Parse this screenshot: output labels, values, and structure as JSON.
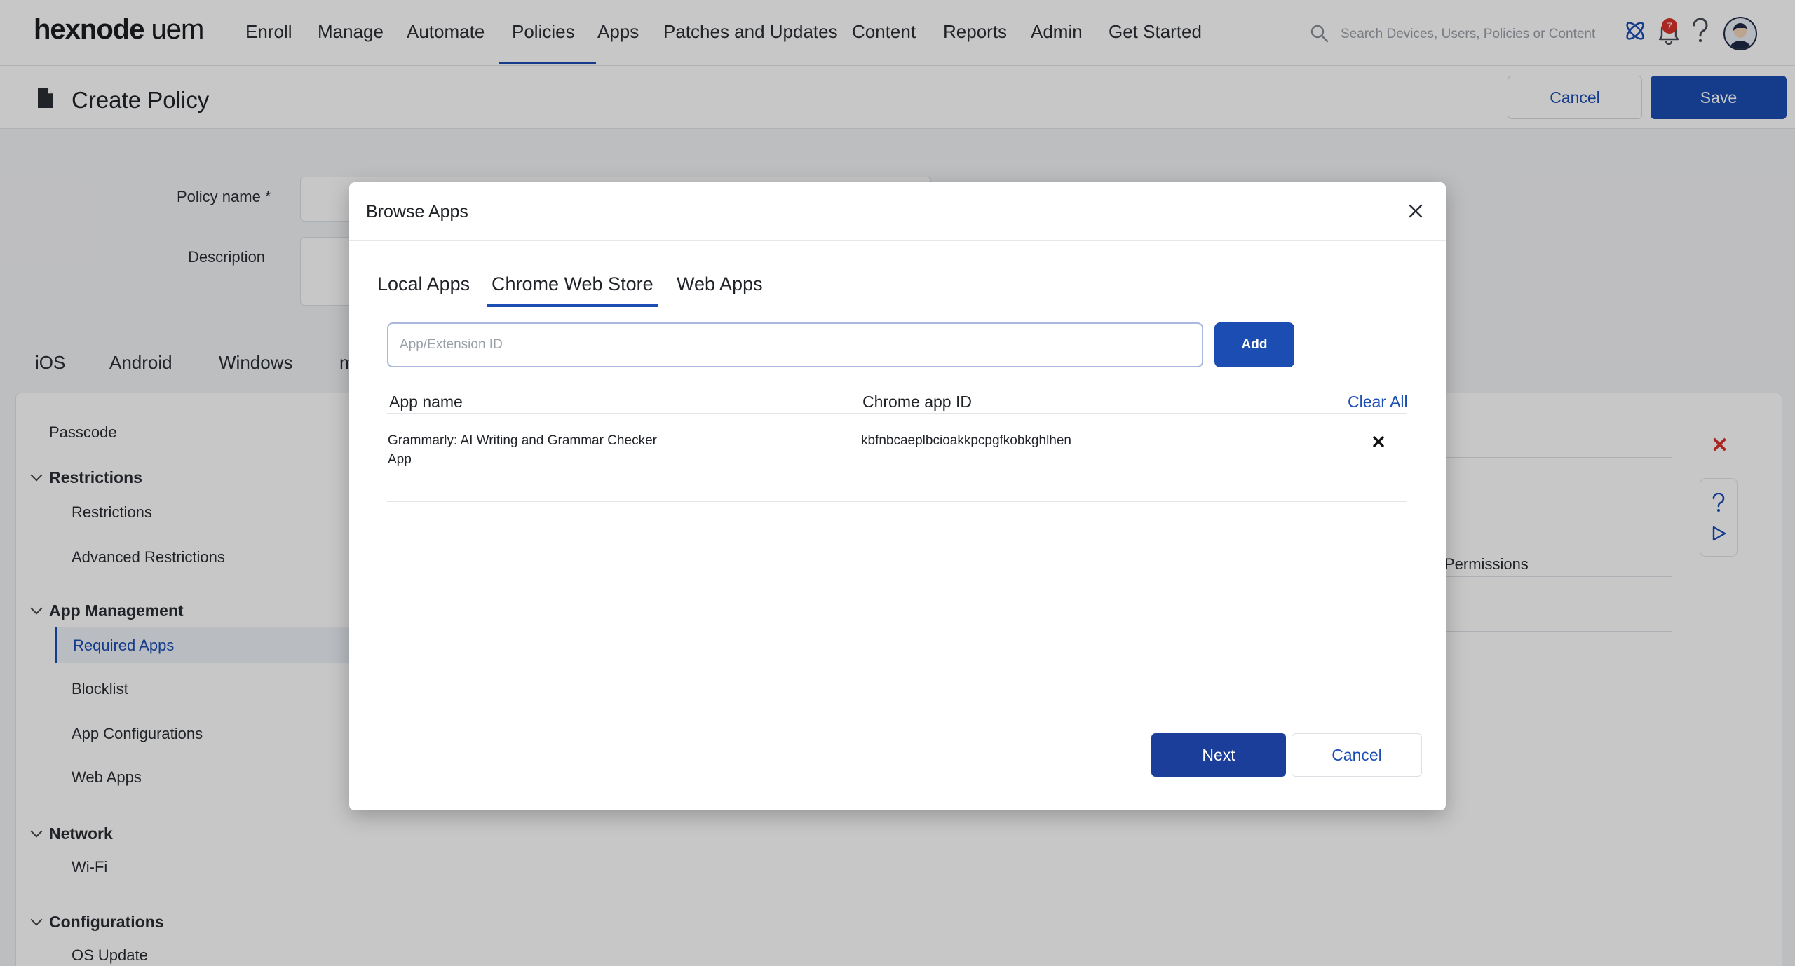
{
  "brand": {
    "name": "hexnode",
    "product": "uem",
    "accent": "#1b4db3"
  },
  "nav": {
    "items": [
      {
        "label": "Enroll"
      },
      {
        "label": "Manage"
      },
      {
        "label": "Automate"
      },
      {
        "label": "Policies",
        "active": true
      },
      {
        "label": "Apps"
      },
      {
        "label": "Patches and Updates"
      },
      {
        "label": "Content"
      },
      {
        "label": "Reports"
      },
      {
        "label": "Admin"
      },
      {
        "label": "Get Started"
      }
    ],
    "search_placeholder": "Search Devices, Users, Policies or Content",
    "notification_count": "7"
  },
  "subheader": {
    "title": "Create Policy",
    "cancel_label": "Cancel",
    "save_label": "Save"
  },
  "form": {
    "policy_name_label": "Policy name *",
    "description_label": "Description"
  },
  "platform_tabs": [
    "iOS",
    "Android",
    "Windows",
    "m"
  ],
  "sidebar": {
    "passcode": "Passcode",
    "restrictions_group": "Restrictions",
    "restrictions": "Restrictions",
    "advanced_restrictions": "Advanced Restrictions",
    "app_management_group": "App Management",
    "required_apps": "Required Apps",
    "blocklist": "Blocklist",
    "app_configurations": "App Configurations",
    "web_apps": "Web Apps",
    "network_group": "Network",
    "wifi": "Wi-Fi",
    "configurations_group": "Configurations",
    "os_update": "OS Update"
  },
  "background_right": {
    "permissions": "Permissions"
  },
  "modal": {
    "title": "Browse Apps",
    "tabs": [
      {
        "label": "Local Apps"
      },
      {
        "label": "Chrome Web Store",
        "active": true
      },
      {
        "label": "Web Apps"
      }
    ],
    "input_placeholder": "App/Extension ID",
    "add_label": "Add",
    "columns": {
      "app_name": "App name",
      "chrome_app_id": "Chrome app ID",
      "clear_all": "Clear All"
    },
    "rows": [
      {
        "app_name_line1": "Grammarly: AI Writing and Grammar Checker",
        "app_name_line2": "App",
        "chrome_app_id": "kbfnbcaeplbcioakkpcpgfkobkghlhen"
      }
    ],
    "next_label": "Next",
    "cancel_label": "Cancel"
  }
}
